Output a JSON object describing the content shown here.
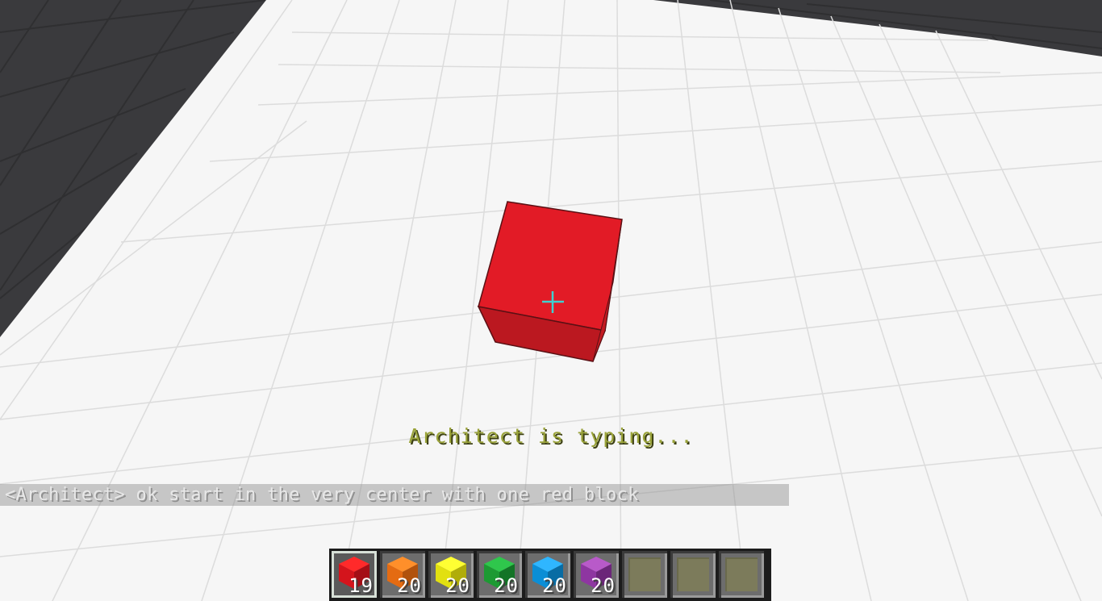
{
  "hud": {
    "typing_indicator": "Architect is typing...",
    "chat_message": "<Architect> ok start in the very center with one red block"
  },
  "crosshair": {
    "icon": "crosshair-icon",
    "color": "#3fd0d0"
  },
  "world": {
    "placed_blocks": [
      {
        "color": "red",
        "top": "#e21b26",
        "left": "#cf1e24",
        "front": "#bb1820"
      }
    ],
    "ground_color": "#f6f6f6",
    "grid_line_color": "#dcdcdc",
    "void_color": "#3a3a3d"
  },
  "hotbar": {
    "selected_index": 0,
    "slots": [
      {
        "item": "red-block",
        "count": "19",
        "top": "#ff2a2a",
        "left": "#d4141c",
        "right": "#a40e16"
      },
      {
        "item": "orange-block",
        "count": "20",
        "top": "#ff8f2a",
        "left": "#e46b12",
        "right": "#b1520c"
      },
      {
        "item": "yellow-block",
        "count": "20",
        "top": "#ffff33",
        "left": "#e2e010",
        "right": "#b0ad0a"
      },
      {
        "item": "green-block",
        "count": "20",
        "top": "#2fc74c",
        "left": "#1d9a33",
        "right": "#137426"
      },
      {
        "item": "blue-block",
        "count": "20",
        "top": "#2fb6ff",
        "left": "#0b8ed6",
        "right": "#086ca4"
      },
      {
        "item": "purple-block",
        "count": "20",
        "top": "#b85ac9",
        "left": "#8e36a1",
        "right": "#6b2679"
      },
      {
        "item": "empty"
      },
      {
        "item": "empty"
      },
      {
        "item": "empty"
      }
    ]
  }
}
